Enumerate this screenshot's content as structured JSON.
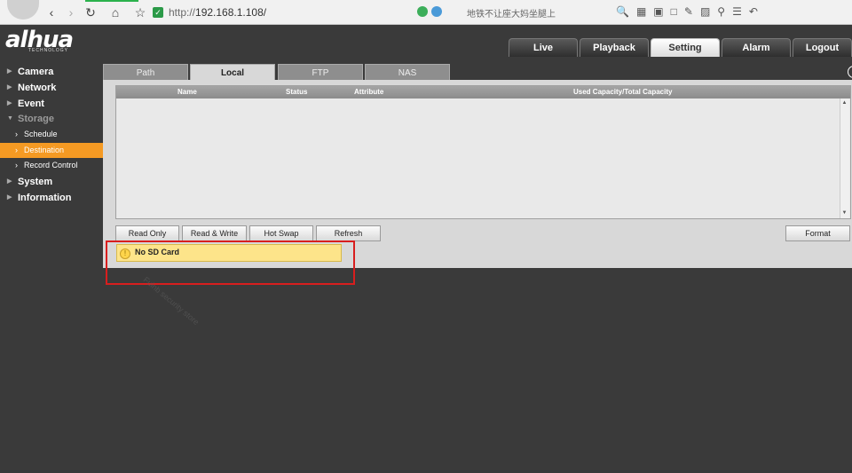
{
  "browser": {
    "url_scheme": "http://",
    "url_host": "192.168.1.108/",
    "search_hint": "地铁不让座大妈坐腿上"
  },
  "app": {
    "logo_text": "alhua",
    "logo_sub": "TECHNOLOGY",
    "top_tabs": [
      {
        "label": "Live",
        "active": false
      },
      {
        "label": "Playback",
        "active": false
      },
      {
        "label": "Setting",
        "active": true
      },
      {
        "label": "Alarm",
        "active": false
      },
      {
        "label": "Logout",
        "active": false
      }
    ]
  },
  "sidebar": {
    "items": [
      {
        "label": "Camera"
      },
      {
        "label": "Network"
      },
      {
        "label": "Event"
      },
      {
        "label": "Storage",
        "expanded": true
      },
      {
        "label": "System"
      },
      {
        "label": "Information"
      }
    ],
    "storage_sub": [
      {
        "label": "Schedule",
        "active": false
      },
      {
        "label": "Destination",
        "active": true
      },
      {
        "label": "Record Control",
        "active": false
      }
    ]
  },
  "sub_tabs": [
    {
      "label": "Path",
      "active": false
    },
    {
      "label": "Local",
      "active": true
    },
    {
      "label": "FTP",
      "active": false
    },
    {
      "label": "NAS",
      "active": false
    }
  ],
  "table": {
    "columns": [
      "Name",
      "Status",
      "Attribute",
      "Used Capacity/Total Capacity"
    ],
    "rows": []
  },
  "buttons": {
    "read_only": "Read Only",
    "read_write": "Read & Write",
    "hot_swap": "Hot Swap",
    "refresh": "Refresh",
    "format": "Format"
  },
  "alert": {
    "message": "No SD Card"
  },
  "watermark": "Fulnb security store",
  "colors": {
    "accent": "#f59a23",
    "alert_bg": "#fde48a",
    "highlight": "#d81e1e"
  }
}
